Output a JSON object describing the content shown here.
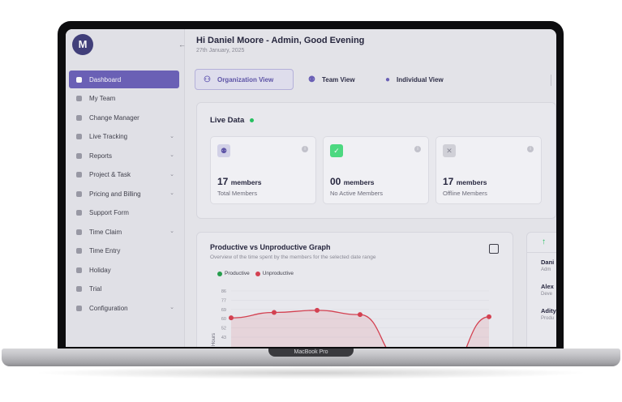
{
  "device": {
    "label": "MacBook Pro"
  },
  "app": {
    "logo": "M"
  },
  "header": {
    "greeting": "Hi Daniel Moore - Admin, Good Evening",
    "date": "27th January, 2025"
  },
  "sidebar": {
    "items": [
      {
        "label": "Dashboard",
        "icon": "dashboard-icon",
        "active": true,
        "expandable": false
      },
      {
        "label": "My Team",
        "icon": "team-icon",
        "expandable": false
      },
      {
        "label": "Change Manager",
        "icon": "user-icon",
        "expandable": false
      },
      {
        "label": "Live Tracking",
        "icon": "tracking-icon",
        "expandable": true
      },
      {
        "label": "Reports",
        "icon": "report-icon",
        "expandable": true
      },
      {
        "label": "Project & Task",
        "icon": "task-icon",
        "expandable": true
      },
      {
        "label": "Pricing and Billing",
        "icon": "billing-icon",
        "expandable": true
      },
      {
        "label": "Support Form",
        "icon": "support-icon",
        "expandable": false
      },
      {
        "label": "Time Claim",
        "icon": "claim-icon",
        "expandable": true
      },
      {
        "label": "Time Entry",
        "icon": "clock-icon",
        "expandable": false
      },
      {
        "label": "Holiday",
        "icon": "holiday-icon",
        "expandable": false
      },
      {
        "label": "Trial",
        "icon": "trial-icon",
        "expandable": false
      },
      {
        "label": "Configuration",
        "icon": "settings-icon",
        "expandable": true
      }
    ]
  },
  "tabs": [
    {
      "label": "Organization View",
      "icon": "organization-icon",
      "active": true
    },
    {
      "label": "Team View",
      "icon": "team-icon"
    },
    {
      "label": "Individual View",
      "icon": "person-icon"
    }
  ],
  "live_data": {
    "title": "Live Data",
    "status_color": "#22c55e",
    "cards": [
      {
        "value": "17",
        "unit": "members",
        "label": "Total Members",
        "icon": "members-icon"
      },
      {
        "value": "00",
        "unit": "members",
        "label": "No Active Members",
        "icon": "check-icon"
      },
      {
        "value": "17",
        "unit": "members",
        "label": "Offline Members",
        "icon": "x-icon"
      }
    ]
  },
  "graph": {
    "title": "Productive vs Unproductive Graph",
    "subtitle": "Overview of the time spent by the members for the selected date range",
    "legend": [
      {
        "name": "Productive",
        "color": "#22a04a"
      },
      {
        "name": "Unproductive",
        "color": "#d93f4f"
      }
    ]
  },
  "chart_data": {
    "type": "area",
    "ylabel": "Hours",
    "ylim": [
      43,
      86
    ],
    "yticks": [
      "86",
      "77",
      "69",
      "60",
      "52",
      "43"
    ],
    "series": [
      {
        "name": "Unproductive",
        "values": [
          61,
          66,
          68,
          64,
          20,
          10,
          62
        ]
      }
    ]
  },
  "side_panel": {
    "members": [
      {
        "name": "Dani",
        "sub": "Adm"
      },
      {
        "name": "Alex",
        "sub": "Deve"
      },
      {
        "name": "Adity",
        "sub": "Produ"
      }
    ]
  }
}
